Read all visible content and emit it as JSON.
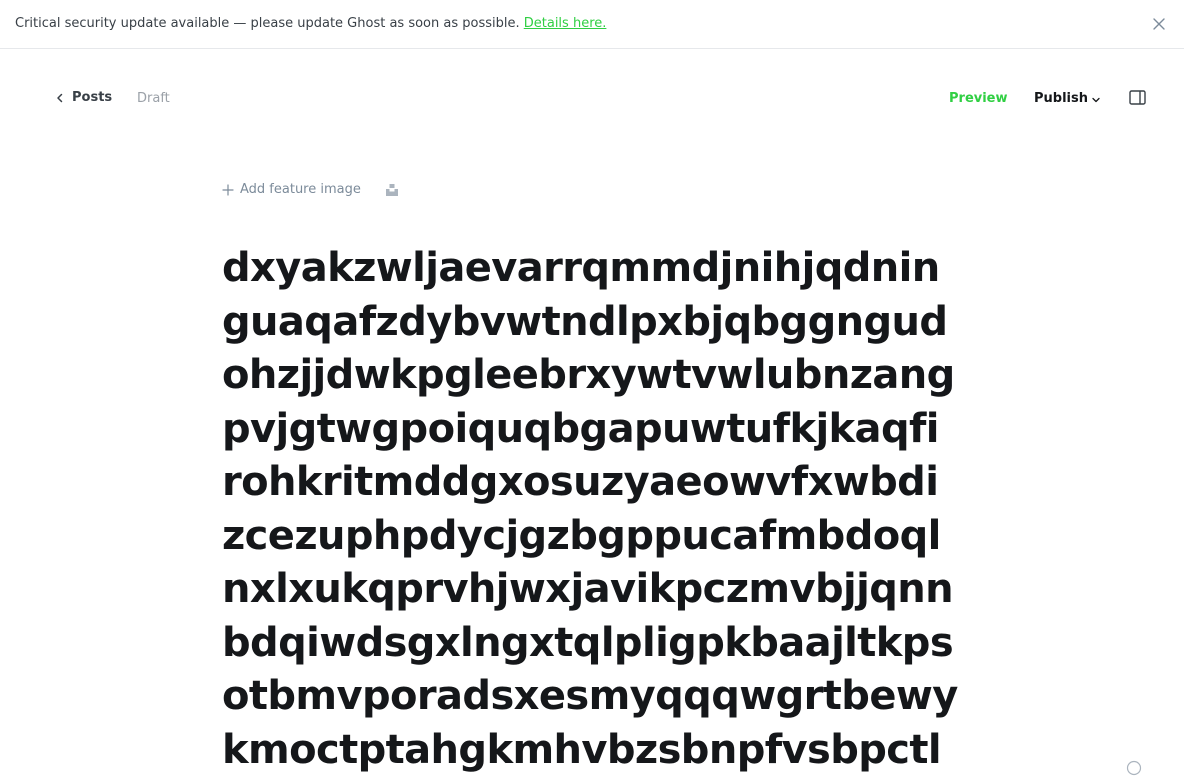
{
  "banner": {
    "message": "Critical security update available — please update Ghost as soon as possible.",
    "link_text": "Details here.",
    "close_icon": "close-icon"
  },
  "topbar": {
    "back_label": "Posts",
    "status": "Draft",
    "preview_label": "Preview",
    "publish_label": "Publish",
    "sidebar_icon": "sidebar-toggle-icon"
  },
  "feature": {
    "add_label": "Add feature image",
    "unsplash_icon": "unsplash-icon"
  },
  "post": {
    "title_lines": [
      "dxyakzwljaevarrqmmdjnihjqdnin",
      "guaqafzdybvwtndlpxbjqbggngud",
      "ohzjjdwkpgleebrxywtvwlubnzang",
      "pvjgtwgpoiquqbgapuwtufkjkaqfi",
      "rohkritmddgxosuzyaeowvfxwbdi",
      "zcezuphpdycjgzbgppucafmbdoql",
      "nxlxukqprvhjwxjavikpczmvbjjqnn",
      "bdqiwdsgxlngxtqlpligpkbaajltkps",
      "otbmvporadsxesmyqqqwgrtbewy",
      "kmoctptahgkmhvbzsbnpfvsbpctl"
    ]
  },
  "colors": {
    "accent_green": "#30cf43",
    "text_dark": "#15171a",
    "text_muted": "#9ba1a8"
  }
}
